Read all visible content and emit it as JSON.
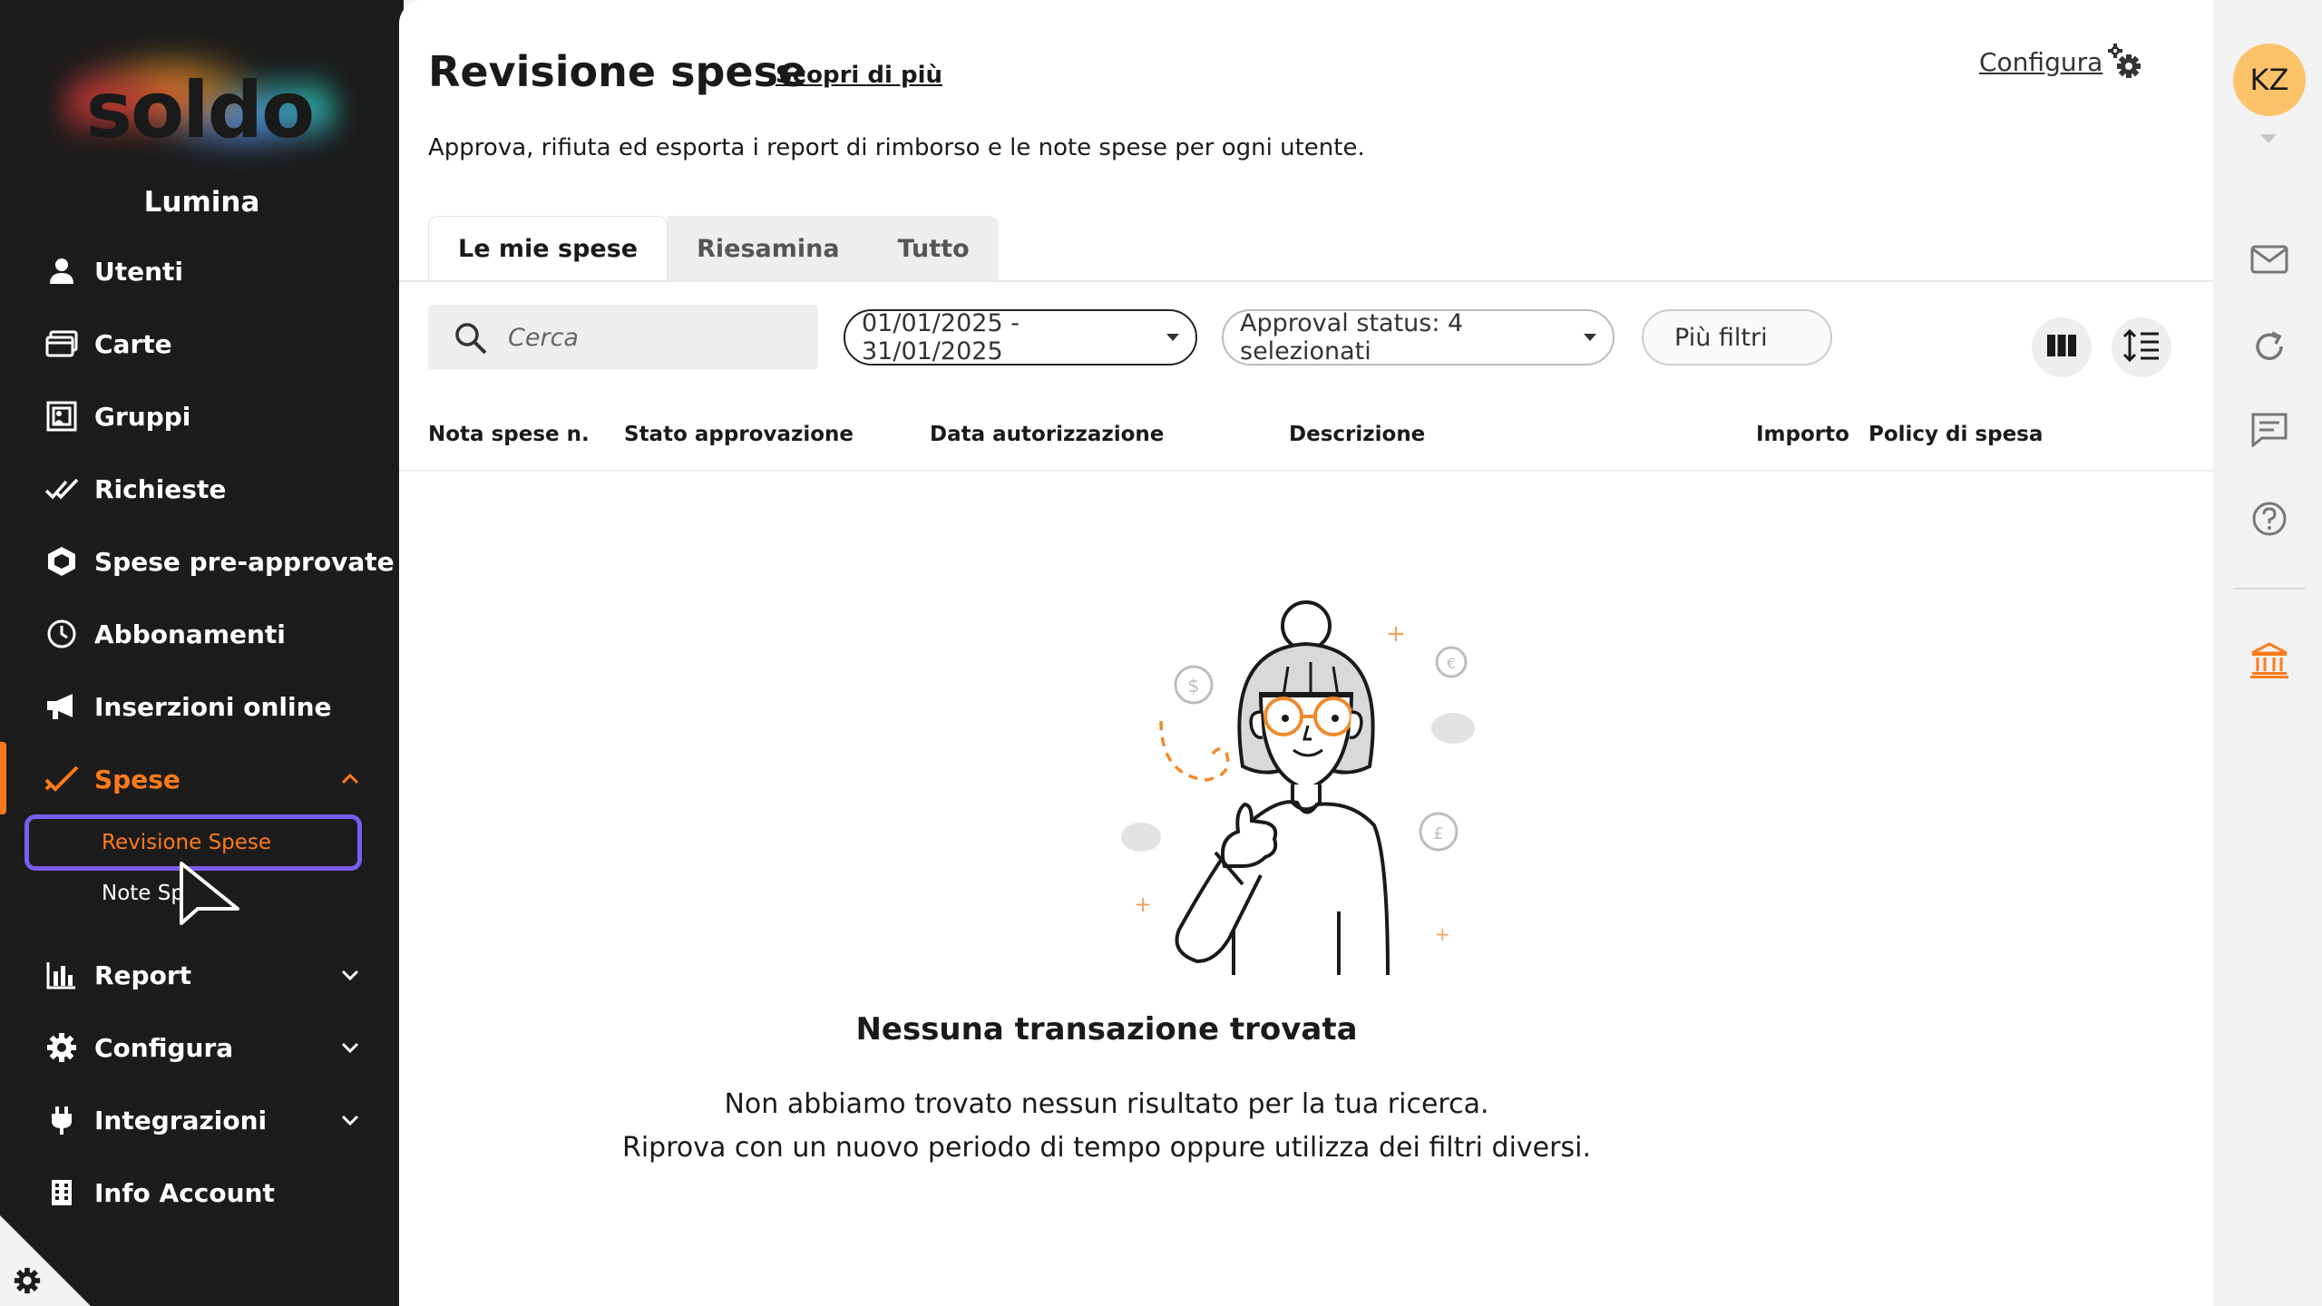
{
  "app": {
    "brand": "soldo",
    "company": "Lumina"
  },
  "sidebar": {
    "items": [
      {
        "label": "Utenti",
        "icon": "user-icon"
      },
      {
        "label": "Carte",
        "icon": "cards-icon"
      },
      {
        "label": "Gruppi",
        "icon": "groups-icon"
      },
      {
        "label": "Richieste",
        "icon": "double-check-icon"
      },
      {
        "label": "Spese pre-approvate",
        "icon": "hexagon-icon"
      },
      {
        "label": "Abbonamenti",
        "icon": "clock-icon"
      },
      {
        "label": "Inserzioni online",
        "icon": "megaphone-icon"
      },
      {
        "label": "Spese",
        "icon": "check-icon",
        "active": true,
        "expanded": true
      },
      {
        "label": "Report",
        "icon": "bar-chart-icon"
      },
      {
        "label": "Configura",
        "icon": "gear-icon"
      },
      {
        "label": "Integrazioni",
        "icon": "plug-icon"
      },
      {
        "label": "Info Account",
        "icon": "building-icon"
      }
    ],
    "sub_items": [
      {
        "label": "Revisione Spese",
        "active": true
      },
      {
        "label": "Note Sp"
      }
    ]
  },
  "header": {
    "title": "Revisione spese",
    "learn_more": "Scopri di più",
    "subtitle": "Approva, rifiuta ed esporta i report di rimborso e le note spese per ogni utente.",
    "configure": "Configura"
  },
  "tabs": [
    {
      "label": "Le mie spese",
      "active": true
    },
    {
      "label": "Riesamina"
    },
    {
      "label": "Tutto"
    }
  ],
  "filters": {
    "search_placeholder": "Cerca",
    "date_range": "01/01/2025 - 31/01/2025",
    "approval_status": "Approval status: 4 selezionati",
    "more_filters": "Più filtri"
  },
  "table": {
    "columns": [
      "Nota spese n.",
      "Stato approvazione",
      "Data autorizzazione",
      "Descrizione",
      "Importo",
      "Policy di spesa"
    ]
  },
  "empty_state": {
    "title": "Nessuna transazione trovata",
    "line1": "Non abbiamo trovato nessun risultato per la tua ricerca.",
    "line2": "Riprova con un nuovo periodo di tempo oppure utilizza dei filtri diversi."
  },
  "user": {
    "initials": "KZ"
  },
  "colors": {
    "accent": "#ff7a1a",
    "sidebar_bg": "#1c1c1c",
    "highlight": "#7a5cf0",
    "avatar": "#fbc26a"
  }
}
